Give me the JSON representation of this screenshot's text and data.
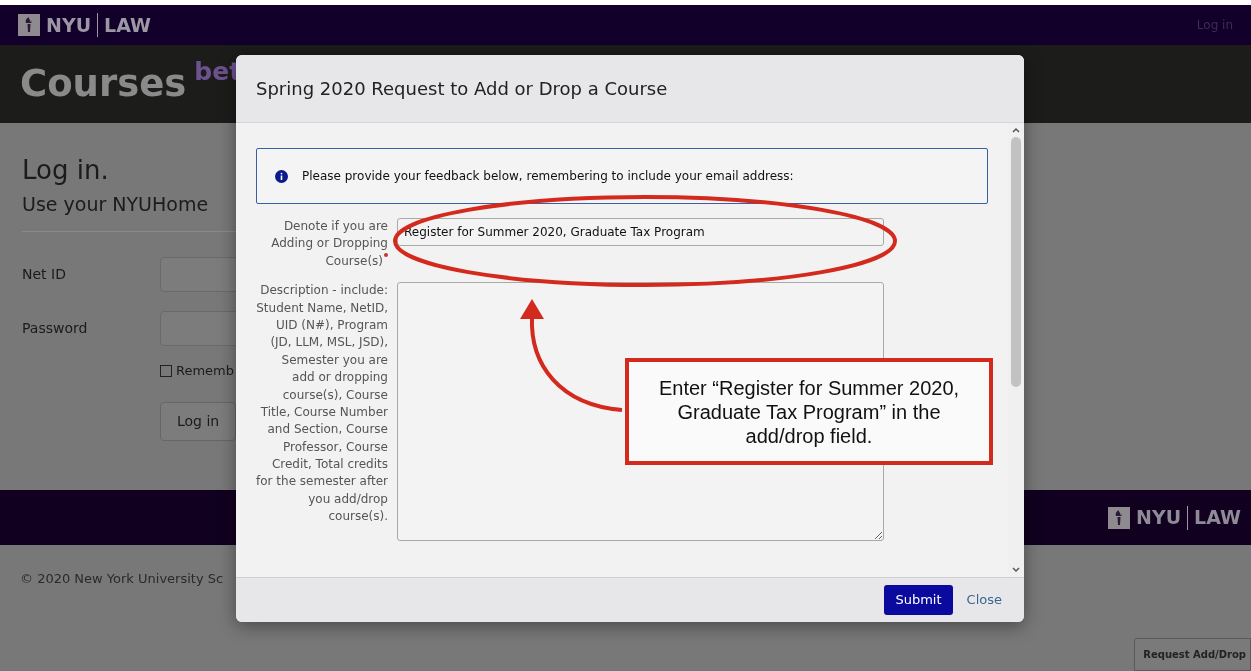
{
  "navbar": {
    "brand": "NYU",
    "brand_2": "LAW",
    "link": "Log in"
  },
  "banner": {
    "title": "Courses",
    "badge": "bet"
  },
  "login": {
    "heading": "Log in.",
    "subheading": "Use your NYUHome",
    "fields": [
      {
        "label": "Net ID"
      },
      {
        "label": "Password"
      }
    ],
    "remember": {
      "label": "Rememb",
      "checked": false
    },
    "button": "Log in"
  },
  "footer": {
    "brand": "NYU",
    "brand_2": "LAW",
    "copyright": "© 2020 New York University Sc"
  },
  "floating_button": "Request Add/Drop",
  "modal": {
    "title": "Spring 2020 Request to Add or Drop a Course",
    "alert": "Please provide your feedback below, remembering to include your email address:",
    "fields": [
      {
        "kind": "input",
        "label": "Denote if you are Adding or Dropping Course(s)",
        "required": true,
        "value": "Register for Summer 2020, Graduate Tax Program"
      },
      {
        "kind": "textarea",
        "label": "Description - include: Student Name, NetID, UID (N#), Program (JD, LLM, MSL, JSD), Semester you are add or dropping course(s), Course Title, Course Number and Section, Course Professor, Course Credit, Total credits for the semester after you add/drop course(s).",
        "required": false
      }
    ],
    "buttons": [
      {
        "label": "Submit",
        "kind": "primary"
      },
      {
        "label": "Close",
        "kind": "link"
      }
    ]
  },
  "annotation": {
    "callout": "Enter “Register for Summer 2020, Graduate Tax Program” in the add/drop field."
  }
}
